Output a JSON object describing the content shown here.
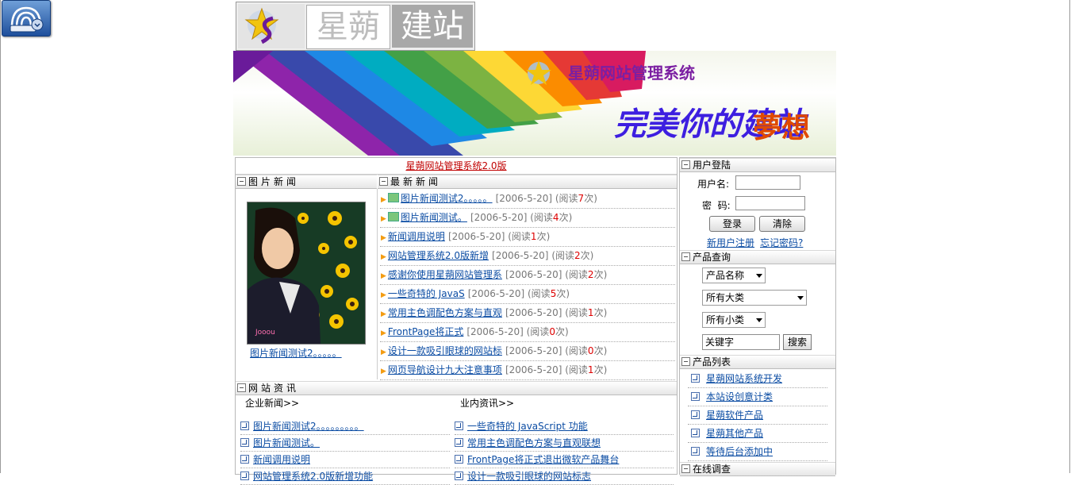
{
  "site": {
    "logo_word1": "星蒴",
    "logo_word2": "建站",
    "banner_title": "星蒴网站管理系统",
    "banner_slogan": "完美你的建站",
    "banner_slogan_b": "夢想",
    "version_link": "星蒴网站管理系统2.0版"
  },
  "sections": {
    "pic_news": "图片新闻",
    "latest_news": "最新新闻",
    "site_info": "网站资讯",
    "login": "用户登陆",
    "product_query": "产品查询",
    "product_list": "产品列表",
    "survey": "在线调查"
  },
  "pic_news": {
    "caption": "图片新闻测试2。。。。。"
  },
  "latest_news": [
    {
      "title": "图片新闻测试2。。。。。",
      "date": "[2006-5-20]",
      "reads_pre": "(阅读",
      "count": "7",
      "reads_post": "次)",
      "has_img": true
    },
    {
      "title": "图片新闻测试。",
      "date": "[2006-5-20]",
      "reads_pre": "(阅读",
      "count": "4",
      "reads_post": "次)",
      "has_img": true
    },
    {
      "title": "新闻调用说明",
      "date": "[2006-5-20]",
      "reads_pre": "(阅读",
      "count": "1",
      "reads_post": "次)",
      "has_img": false
    },
    {
      "title": "网站管理系统2.0版新增",
      "date": "[2006-5-20]",
      "reads_pre": "(阅读",
      "count": "2",
      "reads_post": "次)",
      "has_img": false
    },
    {
      "title": "感谢你使用星蒴网站管理系",
      "date": "[2006-5-20]",
      "reads_pre": "(阅读",
      "count": "2",
      "reads_post": "次)",
      "has_img": false
    },
    {
      "title": "一些奇特的 JavaS",
      "date": "[2006-5-20]",
      "reads_pre": "(阅读",
      "count": "5",
      "reads_post": "次)",
      "has_img": false
    },
    {
      "title": "常用主色调配色方案与直观",
      "date": "[2006-5-20]",
      "reads_pre": "(阅读",
      "count": "1",
      "reads_post": "次)",
      "has_img": false
    },
    {
      "title": "FrontPage将正式",
      "date": "[2006-5-20]",
      "reads_pre": "(阅读",
      "count": "0",
      "reads_post": "次)",
      "has_img": false
    },
    {
      "title": "设计一款吸引眼球的网站标",
      "date": "[2006-5-20]",
      "reads_pre": "(阅读",
      "count": "0",
      "reads_post": "次)",
      "has_img": false
    },
    {
      "title": "网页导航设计九大注意事项",
      "date": "[2006-5-20]",
      "reads_pre": "(阅读",
      "count": "1",
      "reads_post": "次)",
      "has_img": false
    }
  ],
  "site_info": {
    "company_label": "企业新闻>>",
    "industry_label": "业内资讯>>",
    "company": [
      "图片新闻测试2。。。。。。。。。",
      "图片新闻测试。",
      "新闻调用说明",
      "网站管理系统2.0版新增功能"
    ],
    "industry": [
      "一些奇特的 JavaScript 功能",
      "常用主色调配色方案与直观联想",
      "FrontPage将正式退出微软产品舞台",
      "设计一款吸引眼球的网站标志"
    ]
  },
  "login": {
    "username_label": "用户名:",
    "password_label": "密  码:",
    "login_button": "登录",
    "clear_button": "清除",
    "register_link": "新用户注册",
    "forgot_link": "忘记密码?"
  },
  "query": {
    "field_select": "产品名称",
    "category_select": "所有大类",
    "subcategory_select": "所有小类",
    "keyword_value": "关键字",
    "search_button": "搜索"
  },
  "product_list": [
    "星蒴网站系统开发",
    "本站设创意计类",
    "星蒴软件产品",
    "星蒴其他产品",
    "等待后台添加中"
  ]
}
